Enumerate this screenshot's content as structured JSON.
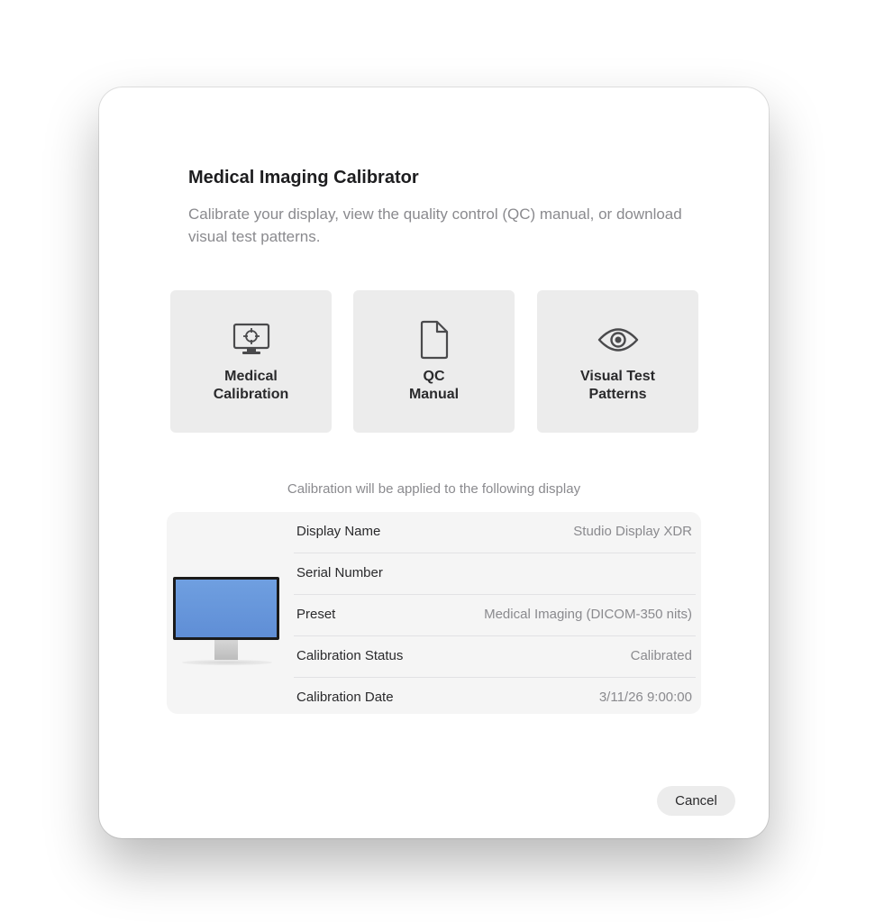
{
  "dialog": {
    "title": "Medical Imaging Calibrator",
    "subtitle": "Calibrate your display, view the quality control (QC) manual, or download visual test patterns."
  },
  "tiles": [
    {
      "label_line1": "Medical",
      "label_line2": "Calibration",
      "icon": "monitor-crosshair-icon"
    },
    {
      "label_line1": "QC",
      "label_line2": "Manual",
      "icon": "document-icon"
    },
    {
      "label_line1": "Visual Test",
      "label_line2": "Patterns",
      "icon": "eye-icon"
    }
  ],
  "display_info": {
    "caption": "Calibration will be applied to the following display",
    "screen_color": "#6f9fe0",
    "rows": [
      {
        "label": "Display Name",
        "value": "Studio Display XDR"
      },
      {
        "label": "Serial Number",
        "value": ""
      },
      {
        "label": "Preset",
        "value": "Medical Imaging (DICOM-350 nits)"
      },
      {
        "label": "Calibration Status",
        "value": "Calibrated"
      },
      {
        "label": "Calibration Date",
        "value": "3/11/26  9:00:00"
      }
    ]
  },
  "footer": {
    "cancel_label": "Cancel"
  }
}
